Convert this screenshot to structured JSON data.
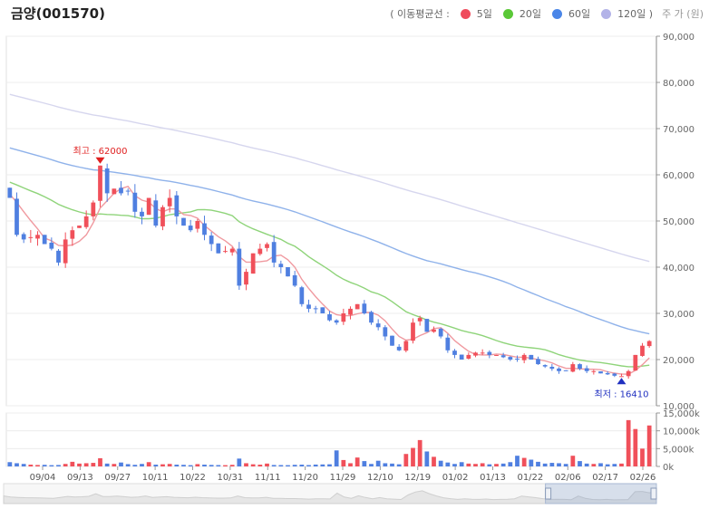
{
  "header": {
    "title": "금양(001570)",
    "ma_label": "( 이동평균선 :",
    "ma5": "5일",
    "ma20": "20일",
    "ma60": "60일",
    "ma120": "120일 )",
    "price_unit": "주 가 (원)"
  },
  "colors": {
    "up": "#f0505a",
    "down": "#4f7fe0",
    "ma5": "#f09aa0",
    "ma20": "#8fd47a",
    "ma60": "#8fb2ea",
    "ma120": "#d6d6ee",
    "legend_ma5": "#ef4b5c",
    "legend_ma20": "#5ac837",
    "legend_ma60": "#4a86e8",
    "legend_ma120": "#b3b3e8"
  },
  "chart_data": {
    "type": "candlestick",
    "x_ticks": [
      "09/04",
      "09/13",
      "09/27",
      "10/11",
      "10/22",
      "10/31",
      "11/11",
      "11/20",
      "11/29",
      "12/10",
      "12/19",
      "01/02",
      "01/13",
      "01/22",
      "02/06",
      "02/17",
      "02/26"
    ],
    "price_axis": {
      "ylim": [
        10000,
        90000
      ],
      "ticks": [
        "10,000",
        "20,000",
        "30,000",
        "40,000",
        "50,000",
        "60,000",
        "70,000",
        "80,000",
        "90,000"
      ]
    },
    "volume_axis": {
      "ylim": [
        0,
        15000
      ],
      "ticks": [
        "0k",
        "5,000k",
        "10,000k",
        "15,000k"
      ]
    },
    "annotations": {
      "high_label": "최고 : 62000",
      "high_value": 62000,
      "low_label": "최저 : 16410",
      "low_value": 16410
    },
    "closes": [
      55000,
      47000,
      46000,
      46500,
      47000,
      45000,
      44000,
      41000,
      46000,
      48000,
      49000,
      51000,
      54000,
      62000,
      56000,
      57000,
      56000,
      56500,
      52000,
      51000,
      55000,
      49000,
      53000,
      55000,
      51000,
      49000,
      48000,
      50000,
      47000,
      45000,
      43000,
      43500,
      44000,
      36000,
      39000,
      43000,
      44000,
      45000,
      41000,
      40000,
      38000,
      36000,
      32000,
      31000,
      31000,
      30000,
      28500,
      28000,
      30000,
      31000,
      32000,
      30000,
      28000,
      27000,
      25000,
      23000,
      22000,
      24000,
      28000,
      29000,
      26000,
      26500,
      25000,
      22000,
      21000,
      20000,
      21000,
      21500,
      21500,
      21000,
      21000,
      20500,
      20000,
      20000,
      21000,
      20000,
      19000,
      18500,
      18000,
      17500,
      17500,
      19000,
      18000,
      17500,
      17500,
      17000,
      16800,
      16500,
      16410,
      17500,
      21000,
      23000,
      24000
    ],
    "high": 62000,
    "low": 16410,
    "volume_k": [
      1200,
      900,
      700,
      500,
      400,
      450,
      350,
      400,
      700,
      1300,
      800,
      900,
      1000,
      2300,
      800,
      700,
      1100,
      650,
      450,
      700,
      1200,
      500,
      600,
      700,
      500,
      450,
      350,
      650,
      500,
      420,
      380,
      350,
      450,
      2200,
      900,
      600,
      500,
      800,
      400,
      380,
      350,
      450,
      500,
      380,
      520,
      560,
      600,
      4500,
      1800,
      900,
      2500,
      1500,
      700,
      1600,
      900,
      800,
      600,
      3500,
      5200,
      7400,
      4200,
      2700,
      1600,
      1100,
      700,
      1200,
      800,
      700,
      900,
      600,
      700,
      800,
      1200,
      3000,
      2400,
      1900,
      1300,
      800,
      1000,
      900,
      700,
      3000,
      1500,
      800,
      700,
      900,
      600,
      700,
      800,
      13000,
      10500,
      5000,
      11500
    ]
  },
  "navigator": {
    "range_start_fraction": 0.83,
    "range_end_fraction": 1.0
  }
}
